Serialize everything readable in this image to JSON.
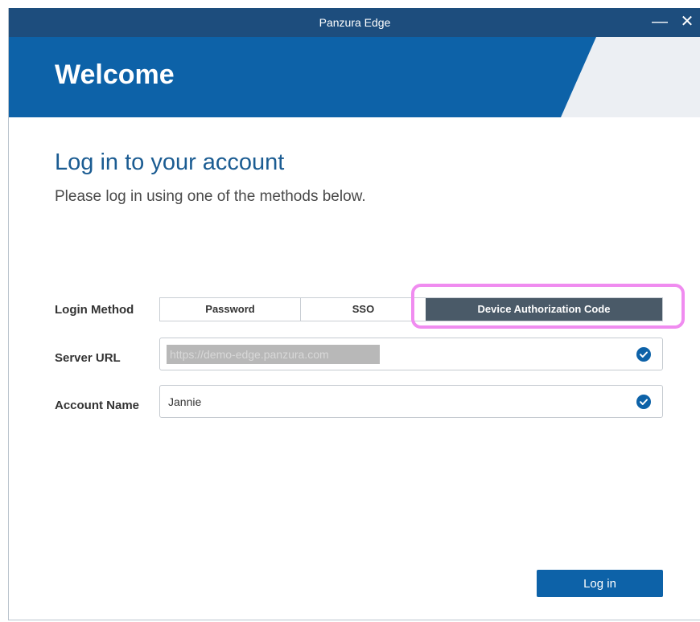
{
  "window": {
    "title": "Panzura Edge",
    "minimize_glyph": "—",
    "close_glyph": "✕"
  },
  "banner": {
    "welcome": "Welcome"
  },
  "main": {
    "heading": "Log in to your account",
    "subheading": "Please log in using one of the methods below."
  },
  "form": {
    "login_method_label": "Login Method",
    "methods": [
      {
        "label": "Password",
        "selected": false
      },
      {
        "label": "SSO",
        "selected": false
      },
      {
        "label": "Device Authorization Code",
        "selected": true
      }
    ],
    "server_url_label": "Server URL",
    "server_url_value": "https://demo-edge.panzura.com",
    "server_url_valid": true,
    "account_name_label": "Account Name",
    "account_name_value": "Jannie",
    "account_name_valid": true,
    "login_button": "Log in"
  },
  "colors": {
    "titlebar": "#1d4d7d",
    "banner": "#0d62a8",
    "accent": "#1b5c92",
    "selected_segment": "#4a5a68",
    "highlight": "#f08cf0"
  }
}
